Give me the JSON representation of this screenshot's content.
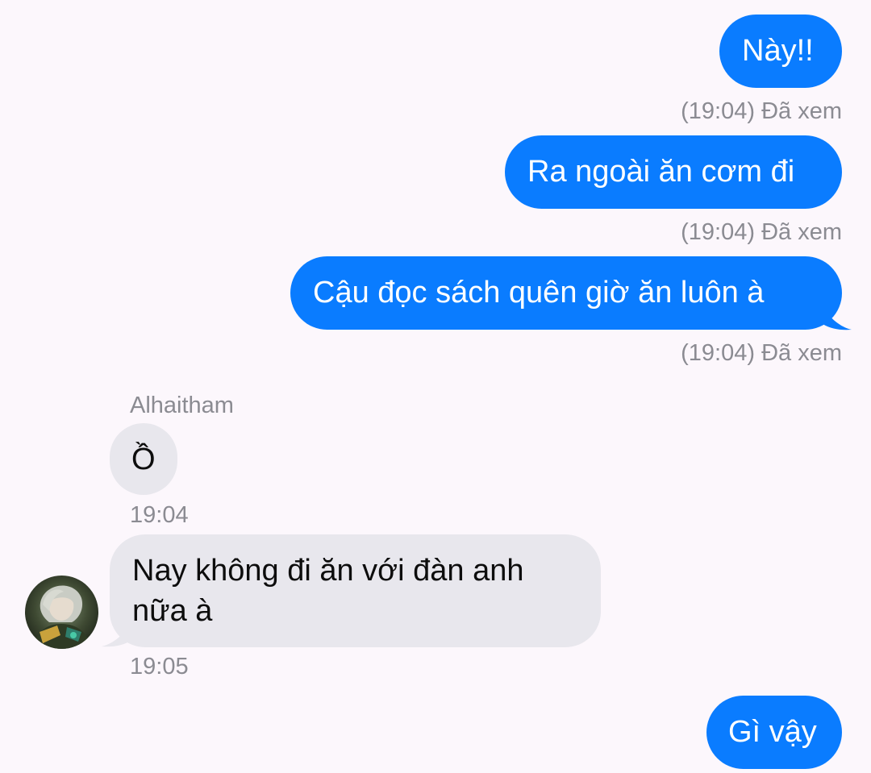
{
  "messages": [
    {
      "id": "m1",
      "direction": "outgoing",
      "text": "Này!!",
      "meta": "(19:04) Đã xem"
    },
    {
      "id": "m2",
      "direction": "outgoing",
      "text": "Ra ngoài ăn cơm đi",
      "meta": "(19:04) Đã xem"
    },
    {
      "id": "m3",
      "direction": "outgoing",
      "text": "Cậu đọc sách quên giờ ăn luôn à",
      "meta": "(19:04) Đã xem"
    },
    {
      "id": "m4",
      "direction": "incoming",
      "sender": "Alhaitham",
      "text": "Ồ",
      "time": "19:04"
    },
    {
      "id": "m5",
      "direction": "incoming",
      "text_line1": "Nay không đi ăn với đàn anh",
      "text_line2": "nữa à",
      "time": "19:05",
      "avatar_icon": "avatar-alhaitham"
    },
    {
      "id": "m6",
      "direction": "outgoing",
      "text": "Gì vậy"
    }
  ],
  "colors": {
    "background": "#fcf7fc",
    "outgoing_bubble": "#0a7cff",
    "incoming_bubble": "#e8e7ed",
    "meta_text": "#8b8b92"
  }
}
